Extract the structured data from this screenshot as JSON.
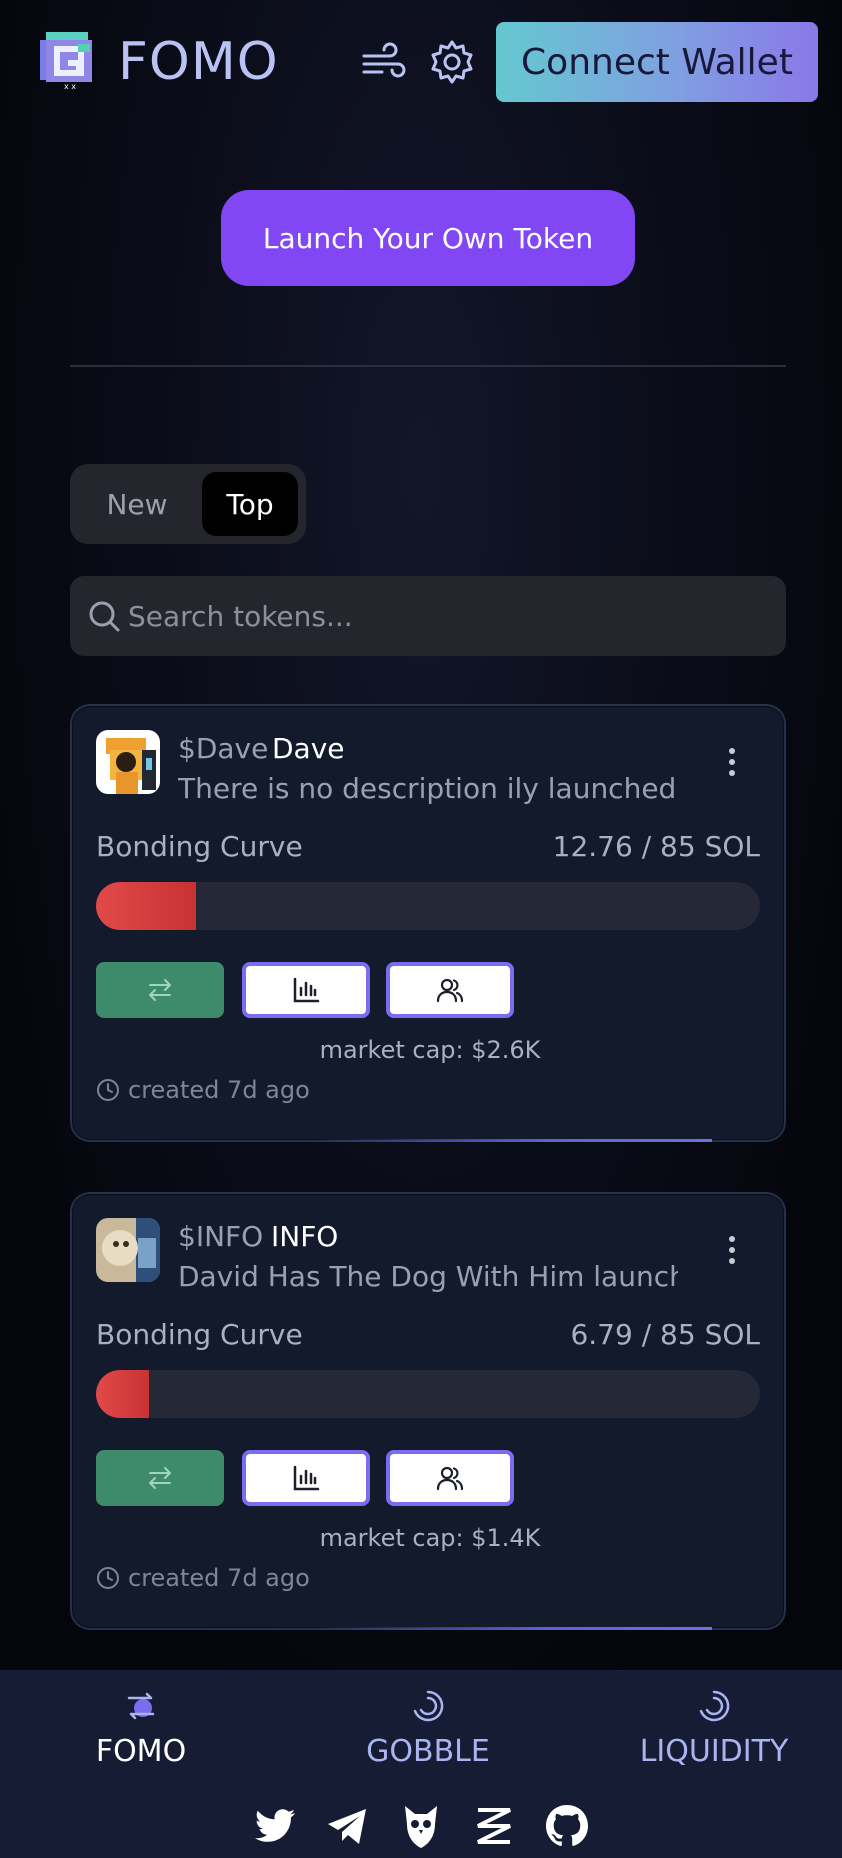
{
  "header": {
    "brand": "FOMO",
    "connect_label": "Connect Wallet"
  },
  "launch_label": "Launch Your Own Token",
  "toggle": {
    "new_label": "New",
    "top_label": "Top",
    "selected": "Top"
  },
  "search": {
    "placeholder": "Search tokens..."
  },
  "tokens": [
    {
      "ticker": "$Dave",
      "name": "Dave",
      "description": "There is no description ily launched ...",
      "bonding_label": "Bonding Curve",
      "bonding_value": "12.76 / 85 SOL",
      "progress": 0.15,
      "market_cap": "market cap: $2.6K",
      "created": "created 7d ago"
    },
    {
      "ticker": "$INFO",
      "name": "INFO",
      "description": "David Has The Dog With Him launch...",
      "bonding_label": "Bonding Curve",
      "bonding_value": "6.79 / 85 SOL",
      "progress": 0.08,
      "market_cap": "market cap: $1.4K",
      "created": "created 7d ago"
    }
  ],
  "bottom_nav": [
    {
      "label": "FOMO",
      "icon": "swap-planet-icon",
      "active": true
    },
    {
      "label": "GOBBLE",
      "icon": "spinner-icon",
      "active": false
    },
    {
      "label": "LIQUIDITY",
      "icon": "spinner-icon",
      "active": false
    }
  ],
  "socials": [
    "twitter-icon",
    "telegram-icon",
    "owl-icon",
    "dex-icon",
    "github-icon"
  ],
  "colors": {
    "accent": "#8247f5",
    "progress": "#e24a4a",
    "swap_button": "#3e8b6b",
    "outline_button": "#7b6cf0",
    "nav_label": "#a9b4f0"
  }
}
